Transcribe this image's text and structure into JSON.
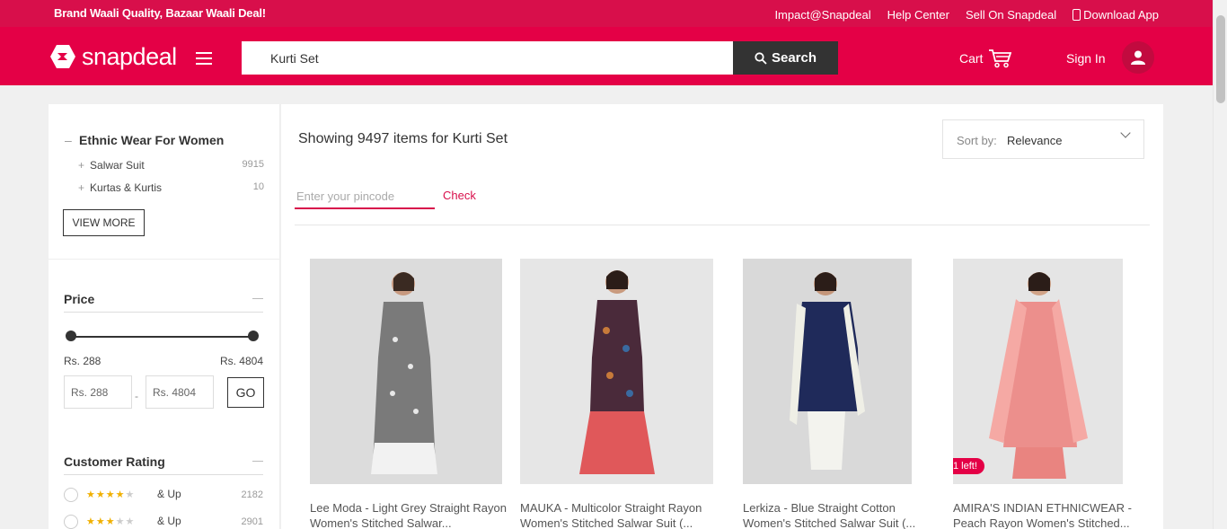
{
  "topbar": {
    "tagline": "Brand Waali Quality, Bazaar Waali Deal!",
    "links": [
      "Impact@Snapdeal",
      "Help Center",
      "Sell On Snapdeal",
      "Download App"
    ]
  },
  "header": {
    "logo_text": "snapdeal",
    "search_value": "Kurti Set",
    "search_button": "Search",
    "cart_label": "Cart",
    "signin_label": "Sign In"
  },
  "sidebar": {
    "category_title": "Ethnic Wear For Women",
    "categories": [
      {
        "label": "Salwar Suit",
        "count": "9915"
      },
      {
        "label": "Kurtas & Kurtis",
        "count": "10"
      }
    ],
    "view_more": "VIEW MORE",
    "price": {
      "title": "Price",
      "min_label": "Rs. 288",
      "max_label": "Rs. 4804",
      "min_input": "Rs. 288",
      "max_input": "Rs. 4804",
      "dash": "-",
      "go": "GO"
    },
    "rating": {
      "title": "Customer Rating",
      "rows": [
        {
          "stars": 4,
          "label": "& Up",
          "count": "2182"
        },
        {
          "stars": 3,
          "label": "& Up",
          "count": "2901"
        }
      ]
    }
  },
  "main": {
    "showing": "Showing 9497 items for Kurti Set",
    "sort_label": "Sort by:",
    "sort_value": "Relevance",
    "pincode_placeholder": "Enter your pincode",
    "check_label": "Check",
    "products": [
      {
        "title": "Lee Moda - Light Grey Straight Rayon Women's Stitched Salwar...",
        "badge": ""
      },
      {
        "title": "MAUKA - Multicolor Straight Rayon Women's Stitched Salwar Suit (...",
        "badge": ""
      },
      {
        "title": "Lerkiza - Blue Straight Cotton Women's Stitched Salwar Suit (...",
        "badge": ""
      },
      {
        "title": "AMIRA'S INDIAN ETHNICWEAR - Peach Rayon Women's Stitched...",
        "badge": "1 left!"
      }
    ]
  },
  "colors": {
    "brand_red": "#e40046",
    "topbar_red": "#d80f4b",
    "search_button_bg": "#333333"
  }
}
